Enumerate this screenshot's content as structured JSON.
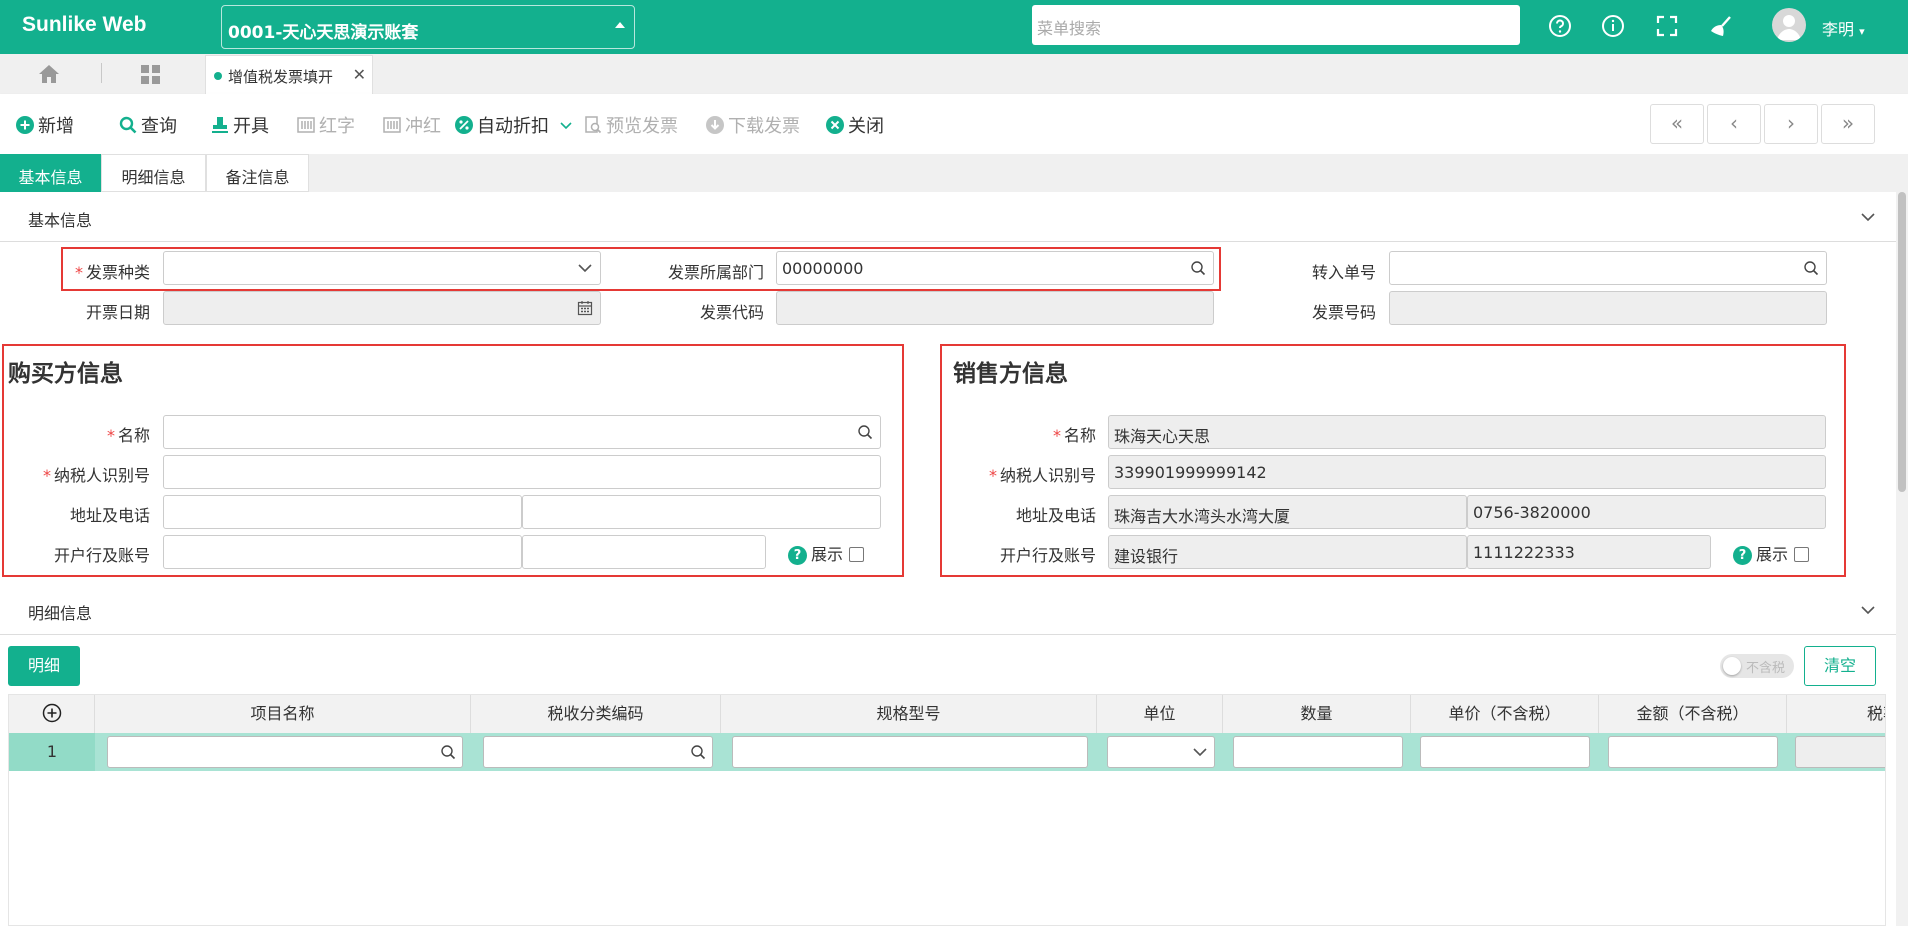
{
  "app": {
    "logo": "Sunlike Web",
    "account": "0001-天心天思演示账套",
    "search_placeholder": "菜单搜索",
    "user": "李明"
  },
  "tabs": {
    "open_tab": "增值税发票填开"
  },
  "toolbar": {
    "new": "新增",
    "query": "查询",
    "issue": "开具",
    "red_letter": "红字",
    "offset": "冲红",
    "auto_discount": "自动折扣",
    "preview": "预览发票",
    "download": "下载发票",
    "close": "关闭"
  },
  "section_tabs": [
    "基本信息",
    "明细信息",
    "备注信息"
  ],
  "basic": {
    "title": "基本信息",
    "invoice_type_label": "发票种类",
    "invoice_type_value": "",
    "dept_label": "发票所属部门",
    "dept_value": "00000000",
    "transfer_label": "转入单号",
    "transfer_value": "",
    "date_label": "开票日期",
    "date_value": "",
    "code_label": "发票代码",
    "code_value": "",
    "number_label": "发票号码",
    "number_value": ""
  },
  "buyer": {
    "title": "购买方信息",
    "name_label": "名称",
    "name_value": "",
    "taxid_label": "纳税人识别号",
    "taxid_value": "",
    "addr_label": "地址及电话",
    "addr_value": "",
    "phone_value": "",
    "bank_label": "开户行及账号",
    "bank_value": "",
    "account_value": "",
    "show_label": "展示"
  },
  "seller": {
    "title": "销售方信息",
    "name_label": "名称",
    "name_value": "珠海天心天思",
    "taxid_label": "纳税人识别号",
    "taxid_value": "339901999999142",
    "addr_label": "地址及电话",
    "addr_value": "珠海吉大水湾头水湾大厦",
    "phone_value": "0756-3820000",
    "bank_label": "开户行及账号",
    "bank_value": "建设银行",
    "account_value": "1111222333",
    "show_label": "展示"
  },
  "detail": {
    "title": "明细信息",
    "detail_button": "明细",
    "tax_toggle": "不含税",
    "clear_button": "清空",
    "columns": [
      "项目名称",
      "税收分类编码",
      "规格型号",
      "单位",
      "数量",
      "单价（不含税）",
      "金额（不含税）",
      "税率"
    ],
    "rows": [
      {
        "index": "1"
      }
    ]
  },
  "colors": {
    "brand": "#13b08e",
    "required": "#e44444",
    "highlight_box": "#e53935"
  }
}
